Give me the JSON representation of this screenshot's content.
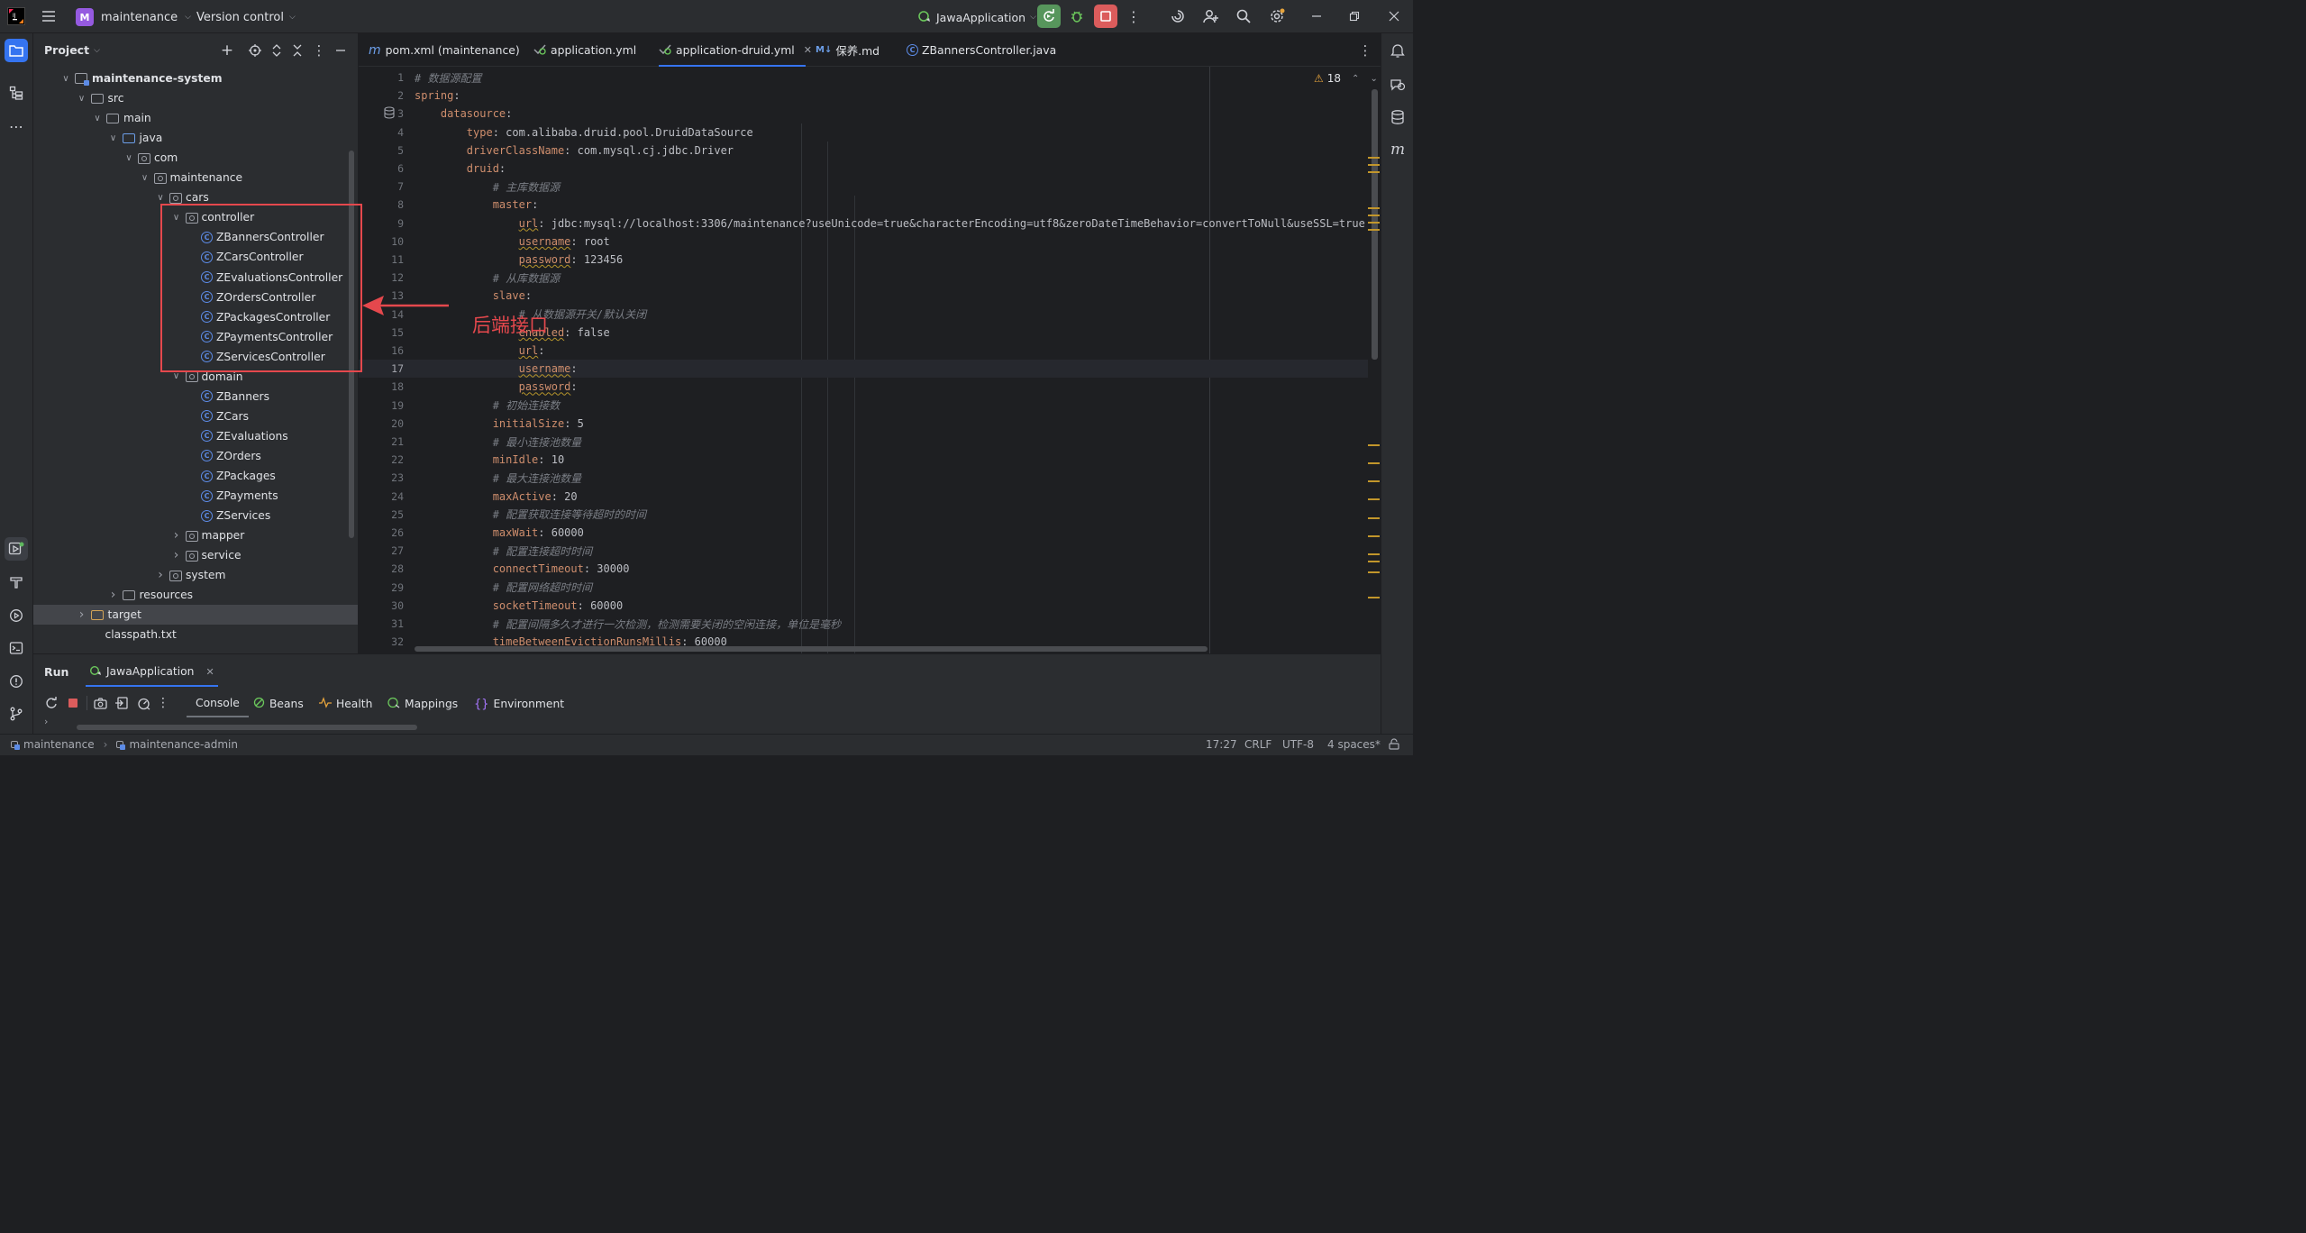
{
  "topbar": {
    "project": "maintenance",
    "project_badge": "M",
    "vcs": "Version control",
    "run_config": "JawaApplication"
  },
  "project_panel": {
    "title": "Project"
  },
  "tree": [
    {
      "label": "maintenance-system",
      "indent": 0,
      "arrow": "open",
      "icon": "module"
    },
    {
      "label": "src",
      "indent": 1,
      "arrow": "open",
      "icon": "folder"
    },
    {
      "label": "main",
      "indent": 2,
      "arrow": "open",
      "icon": "folder"
    },
    {
      "label": "java",
      "indent": 3,
      "arrow": "open",
      "icon": "folder-blue"
    },
    {
      "label": "com",
      "indent": 4,
      "arrow": "open",
      "icon": "package"
    },
    {
      "label": "maintenance",
      "indent": 5,
      "arrow": "open",
      "icon": "package"
    },
    {
      "label": "cars",
      "indent": 6,
      "arrow": "open",
      "icon": "package"
    },
    {
      "label": "controller",
      "indent": 7,
      "arrow": "open",
      "icon": "package"
    },
    {
      "label": "ZBannersController",
      "indent": 8,
      "arrow": "",
      "icon": "class"
    },
    {
      "label": "ZCarsController",
      "indent": 8,
      "arrow": "",
      "icon": "class"
    },
    {
      "label": "ZEvaluationsController",
      "indent": 8,
      "arrow": "",
      "icon": "class"
    },
    {
      "label": "ZOrdersController",
      "indent": 8,
      "arrow": "",
      "icon": "class"
    },
    {
      "label": "ZPackagesController",
      "indent": 8,
      "arrow": "",
      "icon": "class"
    },
    {
      "label": "ZPaymentsController",
      "indent": 8,
      "arrow": "",
      "icon": "class"
    },
    {
      "label": "ZServicesController",
      "indent": 8,
      "arrow": "",
      "icon": "class"
    },
    {
      "label": "domain",
      "indent": 7,
      "arrow": "open",
      "icon": "package"
    },
    {
      "label": "ZBanners",
      "indent": 8,
      "arrow": "",
      "icon": "class"
    },
    {
      "label": "ZCars",
      "indent": 8,
      "arrow": "",
      "icon": "class"
    },
    {
      "label": "ZEvaluations",
      "indent": 8,
      "arrow": "",
      "icon": "class"
    },
    {
      "label": "ZOrders",
      "indent": 8,
      "arrow": "",
      "icon": "class"
    },
    {
      "label": "ZPackages",
      "indent": 8,
      "arrow": "",
      "icon": "class"
    },
    {
      "label": "ZPayments",
      "indent": 8,
      "arrow": "",
      "icon": "class"
    },
    {
      "label": "ZServices",
      "indent": 8,
      "arrow": "",
      "icon": "class"
    },
    {
      "label": "mapper",
      "indent": 7,
      "arrow": "closed",
      "icon": "package"
    },
    {
      "label": "service",
      "indent": 7,
      "arrow": "closed",
      "icon": "package"
    },
    {
      "label": "system",
      "indent": 6,
      "arrow": "closed",
      "icon": "package"
    },
    {
      "label": "resources",
      "indent": 3,
      "arrow": "closed",
      "icon": "folder"
    },
    {
      "label": "target",
      "indent": 1,
      "arrow": "closed",
      "icon": "folder-target",
      "selected": true
    },
    {
      "label": "classpath.txt",
      "indent": 1,
      "arrow": "",
      "icon": "file"
    }
  ],
  "annotation": {
    "label": "后端接口",
    "color": "#e5484d"
  },
  "tabs": [
    {
      "label": "pom.xml (maintenance)",
      "icon": "m",
      "active": false
    },
    {
      "label": "application.yml",
      "icon": "yml",
      "active": false
    },
    {
      "label": "application-druid.yml",
      "icon": "yml",
      "active": true
    },
    {
      "label": "保养.md",
      "icon": "M↓",
      "active": false
    },
    {
      "label": "ZBannersController.java",
      "icon": "C",
      "active": false
    }
  ],
  "warnings": {
    "count": "18"
  },
  "code_lines": [
    {
      "n": "1",
      "t": [
        {
          "s": "# 数据源配置",
          "c": "c"
        }
      ]
    },
    {
      "n": "2",
      "t": [
        {
          "s": "spring",
          "c": "k"
        },
        {
          "s": ":",
          "c": "v"
        }
      ]
    },
    {
      "n": "3",
      "t": [
        {
          "s": "    ",
          "c": "v"
        },
        {
          "s": "datasource",
          "c": "k"
        },
        {
          "s": ":",
          "c": "v"
        }
      ]
    },
    {
      "n": "4",
      "t": [
        {
          "s": "        ",
          "c": "v"
        },
        {
          "s": "type",
          "c": "k"
        },
        {
          "s": ": com.alibaba.druid.pool.DruidDataSource",
          "c": "v"
        }
      ]
    },
    {
      "n": "5",
      "t": [
        {
          "s": "        ",
          "c": "v"
        },
        {
          "s": "driverClassName",
          "c": "k"
        },
        {
          "s": ": com.mysql.cj.jdbc.Driver",
          "c": "v"
        }
      ]
    },
    {
      "n": "6",
      "t": [
        {
          "s": "        ",
          "c": "v"
        },
        {
          "s": "druid",
          "c": "k"
        },
        {
          "s": ":",
          "c": "v"
        }
      ]
    },
    {
      "n": "7",
      "t": [
        {
          "s": "            ",
          "c": "v"
        },
        {
          "s": "# 主库数据源",
          "c": "c"
        }
      ]
    },
    {
      "n": "8",
      "t": [
        {
          "s": "            ",
          "c": "v"
        },
        {
          "s": "master",
          "c": "k"
        },
        {
          "s": ":",
          "c": "v"
        }
      ]
    },
    {
      "n": "9",
      "t": [
        {
          "s": "                ",
          "c": "v"
        },
        {
          "s": "url",
          "c": "k w"
        },
        {
          "s": ": jdbc:mysql://localhost:3306/maintenance?useUnicode=true&characterEncoding=utf8&zeroDateTimeBehavior=convertToNull&useSSL=true",
          "c": "v"
        }
      ]
    },
    {
      "n": "10",
      "t": [
        {
          "s": "                ",
          "c": "v"
        },
        {
          "s": "username",
          "c": "k w"
        },
        {
          "s": ": root",
          "c": "v"
        }
      ]
    },
    {
      "n": "11",
      "t": [
        {
          "s": "                ",
          "c": "v"
        },
        {
          "s": "password",
          "c": "k w"
        },
        {
          "s": ": 123456",
          "c": "v"
        }
      ]
    },
    {
      "n": "12",
      "t": [
        {
          "s": "            ",
          "c": "v"
        },
        {
          "s": "# 从库数据源",
          "c": "c"
        }
      ]
    },
    {
      "n": "13",
      "t": [
        {
          "s": "            ",
          "c": "v"
        },
        {
          "s": "slave",
          "c": "k"
        },
        {
          "s": ":",
          "c": "v"
        }
      ]
    },
    {
      "n": "14",
      "t": [
        {
          "s": "                ",
          "c": "v"
        },
        {
          "s": "# 从数据源开关/默认关闭",
          "c": "c"
        }
      ]
    },
    {
      "n": "15",
      "t": [
        {
          "s": "                ",
          "c": "v"
        },
        {
          "s": "enabled",
          "c": "k w"
        },
        {
          "s": ": false",
          "c": "v"
        }
      ]
    },
    {
      "n": "16",
      "t": [
        {
          "s": "                ",
          "c": "v"
        },
        {
          "s": "url",
          "c": "k w"
        },
        {
          "s": ":",
          "c": "v"
        }
      ]
    },
    {
      "n": "17",
      "t": [
        {
          "s": "                ",
          "c": "v"
        },
        {
          "s": "username",
          "c": "k w"
        },
        {
          "s": ":",
          "c": "v"
        }
      ],
      "current": true
    },
    {
      "n": "18",
      "t": [
        {
          "s": "                ",
          "c": "v"
        },
        {
          "s": "password",
          "c": "k w"
        },
        {
          "s": ":",
          "c": "v"
        }
      ]
    },
    {
      "n": "19",
      "t": [
        {
          "s": "            ",
          "c": "v"
        },
        {
          "s": "# 初始连接数",
          "c": "c"
        }
      ]
    },
    {
      "n": "20",
      "t": [
        {
          "s": "            ",
          "c": "v"
        },
        {
          "s": "initialSize",
          "c": "k"
        },
        {
          "s": ": 5",
          "c": "v"
        }
      ]
    },
    {
      "n": "21",
      "t": [
        {
          "s": "            ",
          "c": "v"
        },
        {
          "s": "# 最小连接池数量",
          "c": "c"
        }
      ]
    },
    {
      "n": "22",
      "t": [
        {
          "s": "            ",
          "c": "v"
        },
        {
          "s": "minIdle",
          "c": "k"
        },
        {
          "s": ": 10",
          "c": "v"
        }
      ]
    },
    {
      "n": "23",
      "t": [
        {
          "s": "            ",
          "c": "v"
        },
        {
          "s": "# 最大连接池数量",
          "c": "c"
        }
      ]
    },
    {
      "n": "24",
      "t": [
        {
          "s": "            ",
          "c": "v"
        },
        {
          "s": "maxActive",
          "c": "k"
        },
        {
          "s": ": 20",
          "c": "v"
        }
      ]
    },
    {
      "n": "25",
      "t": [
        {
          "s": "            ",
          "c": "v"
        },
        {
          "s": "# 配置获取连接等待超时的时间",
          "c": "c"
        }
      ]
    },
    {
      "n": "26",
      "t": [
        {
          "s": "            ",
          "c": "v"
        },
        {
          "s": "maxWait",
          "c": "k"
        },
        {
          "s": ": 60000",
          "c": "v"
        }
      ]
    },
    {
      "n": "27",
      "t": [
        {
          "s": "            ",
          "c": "v"
        },
        {
          "s": "# 配置连接超时时间",
          "c": "c"
        }
      ]
    },
    {
      "n": "28",
      "t": [
        {
          "s": "            ",
          "c": "v"
        },
        {
          "s": "connectTimeout",
          "c": "k"
        },
        {
          "s": ": 30000",
          "c": "v"
        }
      ]
    },
    {
      "n": "29",
      "t": [
        {
          "s": "            ",
          "c": "v"
        },
        {
          "s": "# 配置网络超时时间",
          "c": "c"
        }
      ]
    },
    {
      "n": "30",
      "t": [
        {
          "s": "            ",
          "c": "v"
        },
        {
          "s": "socketTimeout",
          "c": "k"
        },
        {
          "s": ": 60000",
          "c": "v"
        }
      ]
    },
    {
      "n": "31",
      "t": [
        {
          "s": "            ",
          "c": "v"
        },
        {
          "s": "# 配置间隔多久才进行一次检测，检测需要关闭的空闲连接，单位是毫秒",
          "c": "c"
        }
      ]
    },
    {
      "n": "32",
      "t": [
        {
          "s": "            ",
          "c": "v"
        },
        {
          "s": "timeBetweenEvictionRunsMillis",
          "c": "k"
        },
        {
          "s": ": 60000",
          "c": "v"
        }
      ]
    }
  ],
  "run_panel": {
    "title": "Run",
    "config_tab": "JawaApplication",
    "subtabs": [
      "Console",
      "Beans",
      "Health",
      "Mappings",
      "Environment"
    ]
  },
  "statusbar": {
    "crumb1": "maintenance",
    "crumb2": "maintenance-admin",
    "position": "17:27",
    "line_sep": "CRLF",
    "encoding": "UTF-8",
    "indent": "4 spaces*"
  }
}
